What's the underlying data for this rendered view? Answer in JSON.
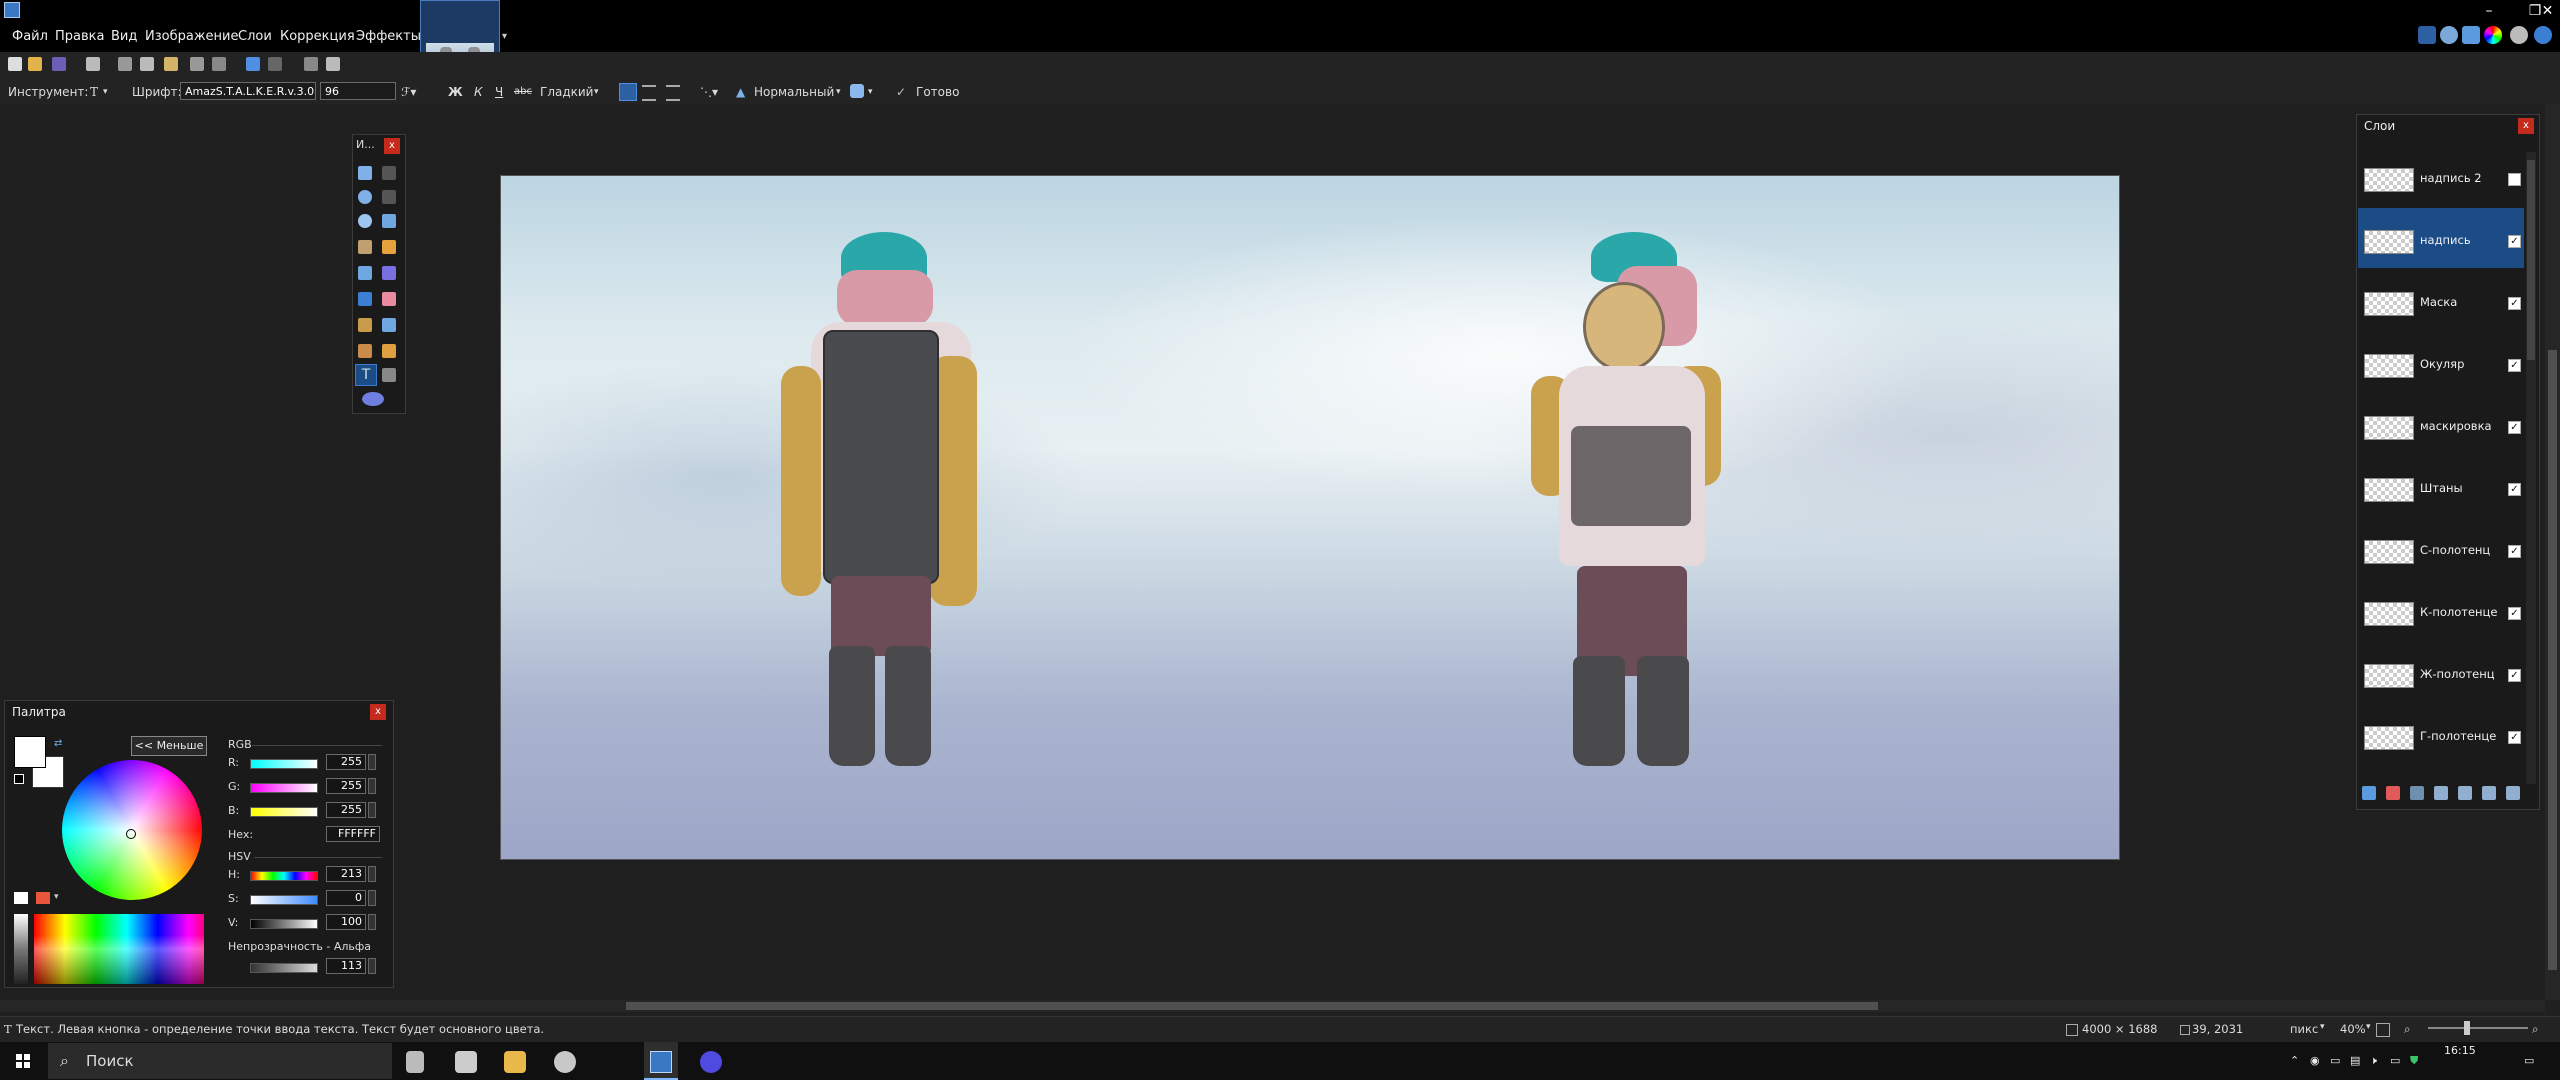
{
  "app": {
    "window_controls": {
      "minimize": "–",
      "restore": "❐",
      "close": "✕"
    },
    "right_icons": [
      "tools-toggle-icon",
      "history-icon",
      "layers-icon",
      "palette-icon",
      "settings-icon",
      "help-icon"
    ]
  },
  "menu": {
    "items": [
      "Файл",
      "Правка",
      "Вид",
      "Изображение",
      "Слои",
      "Коррекция",
      "Эффекты"
    ]
  },
  "toolbar2": {
    "tool_label": "Инструмент:",
    "tool_glyph": "T",
    "font_label": "Шрифт:",
    "font_value": "AmazS.T.A.L.K.E.R.v.3.0",
    "size_value": "96",
    "bold": "Ж",
    "italic": "К",
    "underline": "Ч",
    "strike": "abc",
    "antialias": "Гладкий",
    "blend_mode": "Нормальный",
    "finish": "Готово"
  },
  "tools_window": {
    "title": "И...",
    "close": "x"
  },
  "palette": {
    "title": "Палитра",
    "close": "x",
    "less_button": "<< Меньше",
    "rgb_label": "RGB",
    "r_label": "R:",
    "r_value": "255",
    "g_label": "G:",
    "g_value": "255",
    "b_label": "B:",
    "b_value": "255",
    "hex_label": "Hex:",
    "hex_value": "FFFFFF",
    "hsv_label": "HSV",
    "h_label": "H:",
    "h_value": "213",
    "s_label": "S:",
    "s_value": "0",
    "v_label": "V:",
    "v_value": "100",
    "opacity_label": "Непрозрачность - Альфа",
    "opacity_value": "113",
    "primary_color": "#FFFFFF",
    "secondary_color": "#FFFFFF"
  },
  "layers": {
    "title": "Слои",
    "close": "x",
    "items": [
      {
        "name": "надпись 2",
        "visible": false,
        "selected": false
      },
      {
        "name": "надпись",
        "visible": true,
        "selected": true
      },
      {
        "name": "Маска",
        "visible": true,
        "selected": false
      },
      {
        "name": "Окуляр",
        "visible": true,
        "selected": false
      },
      {
        "name": "маскировка",
        "visible": true,
        "selected": false
      },
      {
        "name": "Штаны",
        "visible": true,
        "selected": false
      },
      {
        "name": "С-полотенц",
        "visible": true,
        "selected": false
      },
      {
        "name": "К-полотенце",
        "visible": true,
        "selected": false
      },
      {
        "name": "Ж-полотенц",
        "visible": true,
        "selected": false
      },
      {
        "name": "Г-полотенце",
        "visible": true,
        "selected": false
      }
    ]
  },
  "status": {
    "hint": "Текст. Левая кнопка - определение точки ввода текста. Текст будет основного цвета.",
    "image_size": "4000 × 1688",
    "cursor_pos": "39, 2031",
    "units": "пикс",
    "zoom": "40%"
  },
  "taskbar": {
    "search_placeholder": "Поиск",
    "time": "16:15"
  }
}
